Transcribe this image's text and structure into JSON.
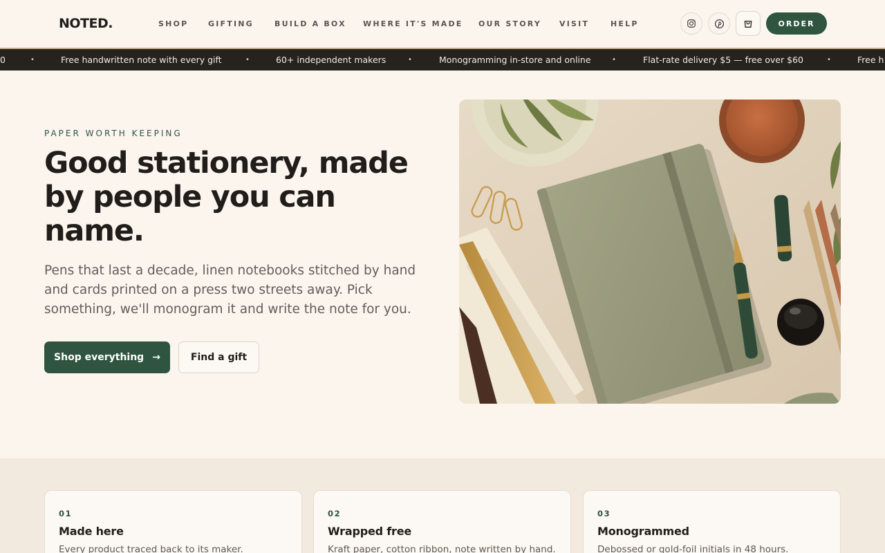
{
  "brand": {
    "logo": "NOTED.",
    "accent": "#2f5540",
    "background": "#fbf5ee",
    "ink": "#201d1a"
  },
  "nav": {
    "items": [
      "SHOP",
      "GIFTING",
      "BUILD A BOX",
      "WHERE IT'S MADE",
      "OUR STORY",
      "VISIT",
      "HELP"
    ]
  },
  "header_actions": {
    "instagram_icon": "instagram-icon",
    "pinterest_icon": "pinterest-icon",
    "cart_icon": "shopping-bag-icon",
    "order_label": "ORDER"
  },
  "ticker": {
    "items": [
      "0",
      "Free handwritten note with every gift",
      "60+ independent makers",
      "Monogramming in-store and online",
      "Flat-rate delivery $5 — free over $60",
      "Free h"
    ],
    "separator": "•"
  },
  "hero": {
    "eyebrow": "PAPER WORTH KEEPING",
    "title": "Good stationery, made by people you can name.",
    "body": "Pens that last a decade, linen notebooks stitched by hand and cards printed on a press two streets away. Pick something, we'll monogram it and write the note for you.",
    "primary_cta": "Shop everything",
    "primary_cta_arrow": "→",
    "secondary_cta": "Find a gift",
    "image_alt": "Flat-lay of a sage linen notebook, fountain pen, ink bottle, pencils and paperclips"
  },
  "features": [
    {
      "num": "01",
      "title": "Made here",
      "desc": "Every product traced back to its maker."
    },
    {
      "num": "02",
      "title": "Wrapped free",
      "desc": "Kraft paper, cotton ribbon, note written by hand."
    },
    {
      "num": "03",
      "title": "Monogrammed",
      "desc": "Debossed or gold-foil initials in 48 hours."
    }
  ]
}
